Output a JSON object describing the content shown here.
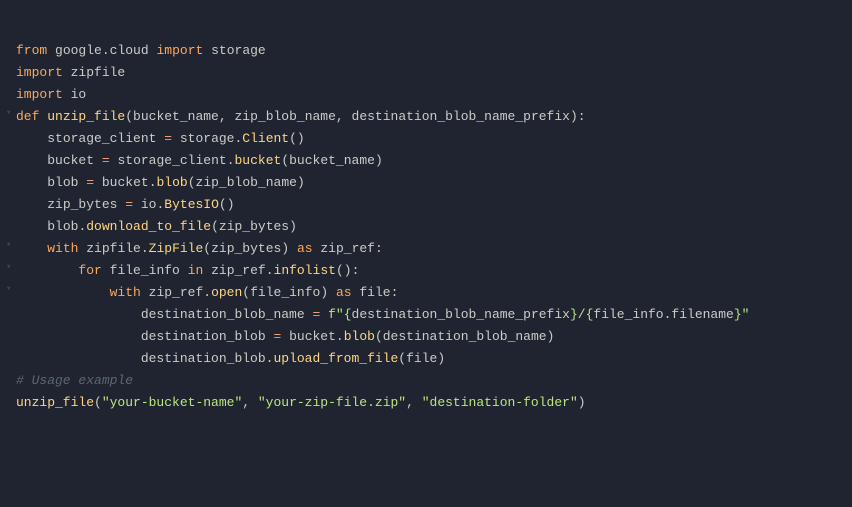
{
  "code": {
    "l1": {
      "kw1": "from",
      "sp1": " ",
      "mod1": "google",
      "dot1": ".",
      "mod2": "cloud",
      "sp2": " ",
      "kw2": "import",
      "sp3": " ",
      "mod3": "storage"
    },
    "l2": {
      "kw": "import",
      "sp": " ",
      "mod": "zipfile"
    },
    "l3": {
      "kw": "import",
      "sp": " ",
      "mod": "io"
    },
    "l4": {
      "text": ""
    },
    "l5": {
      "kw": "def",
      "sp": " ",
      "fn": "unzip_file",
      "lp": "(",
      "p1": "bucket_name",
      "c1": ", ",
      "p2": "zip_blob_name",
      "c2": ", ",
      "p3": "destination_blob_name_prefix",
      "rp": ")",
      "colon": ":"
    },
    "l6": {
      "ind": "    ",
      "v1": "storage_client",
      "sp1": " ",
      "op": "=",
      "sp2": " ",
      "v2": "storage",
      "dot": ".",
      "call": "Client",
      "lp": "(",
      "rp": ")"
    },
    "l7": {
      "ind": "    ",
      "v1": "bucket",
      "sp1": " ",
      "op": "=",
      "sp2": " ",
      "v2": "storage_client",
      "dot": ".",
      "call": "bucket",
      "lp": "(",
      "arg": "bucket_name",
      "rp": ")"
    },
    "l8": {
      "ind": "    ",
      "v1": "blob",
      "sp1": " ",
      "op": "=",
      "sp2": " ",
      "v2": "bucket",
      "dot": ".",
      "call": "blob",
      "lp": "(",
      "arg": "zip_blob_name",
      "rp": ")"
    },
    "l9": {
      "ind": "    ",
      "v1": "zip_bytes",
      "sp1": " ",
      "op": "=",
      "sp2": " ",
      "v2": "io",
      "dot": ".",
      "call": "BytesIO",
      "lp": "(",
      "rp": ")"
    },
    "l10": {
      "ind": "    ",
      "v1": "blob",
      "dot": ".",
      "call": "download_to_file",
      "lp": "(",
      "arg": "zip_bytes",
      "rp": ")"
    },
    "l11": {
      "text": ""
    },
    "l12": {
      "ind": "    ",
      "kw": "with",
      "sp": " ",
      "v1": "zipfile",
      "dot": ".",
      "call": "ZipFile",
      "lp": "(",
      "arg": "zip_bytes",
      "rp": ")",
      "sp2": " ",
      "as": "as",
      "sp3": " ",
      "v2": "zip_ref",
      "colon": ":"
    },
    "l13": {
      "ind": "        ",
      "kw": "for",
      "sp": " ",
      "v1": "file_info",
      "sp2": " ",
      "kw2": "in",
      "sp3": " ",
      "v2": "zip_ref",
      "dot": ".",
      "call": "infolist",
      "lp": "(",
      "rp": ")",
      "colon": ":"
    },
    "l14": {
      "ind": "            ",
      "kw": "with",
      "sp": " ",
      "v1": "zip_ref",
      "dot": ".",
      "call": "open",
      "lp": "(",
      "arg": "file_info",
      "rp": ")",
      "sp2": " ",
      "as": "as",
      "sp3": " ",
      "v2": "file",
      "colon": ":"
    },
    "l15": {
      "ind": "                ",
      "v1": "destination_blob_name",
      "sp1": " ",
      "op": "=",
      "sp2": " ",
      "fpre": "f\"",
      "fbr1": "{",
      "fe1": "destination_blob_name_prefix",
      "fbr1c": "}",
      "fslash": "/",
      "fbr2": "{",
      "fe2a": "file_info",
      "fdot": ".",
      "fe2b": "filename",
      "fbr2c": "}",
      "fq": "\""
    },
    "l16": {
      "ind": "                ",
      "v1": "destination_blob",
      "sp1": " ",
      "op": "=",
      "sp2": " ",
      "v2": "bucket",
      "dot": ".",
      "call": "blob",
      "lp": "(",
      "arg": "destination_blob_name",
      "rp": ")"
    },
    "l17": {
      "ind": "                ",
      "v1": "destination_blob",
      "dot": ".",
      "call": "upload_from_file",
      "lp": "(",
      "arg": "file",
      "rp": ")"
    },
    "l18": {
      "text": ""
    },
    "l19": {
      "comment": "# Usage example"
    },
    "l20": {
      "fn": "unzip_file",
      "lp": "(",
      "s1": "\"your-bucket-name\"",
      "c1": ", ",
      "s2": "\"your-zip-file.zip\"",
      "c2": ", ",
      "s3": "\"destination-folder\"",
      "rp": ")"
    }
  }
}
